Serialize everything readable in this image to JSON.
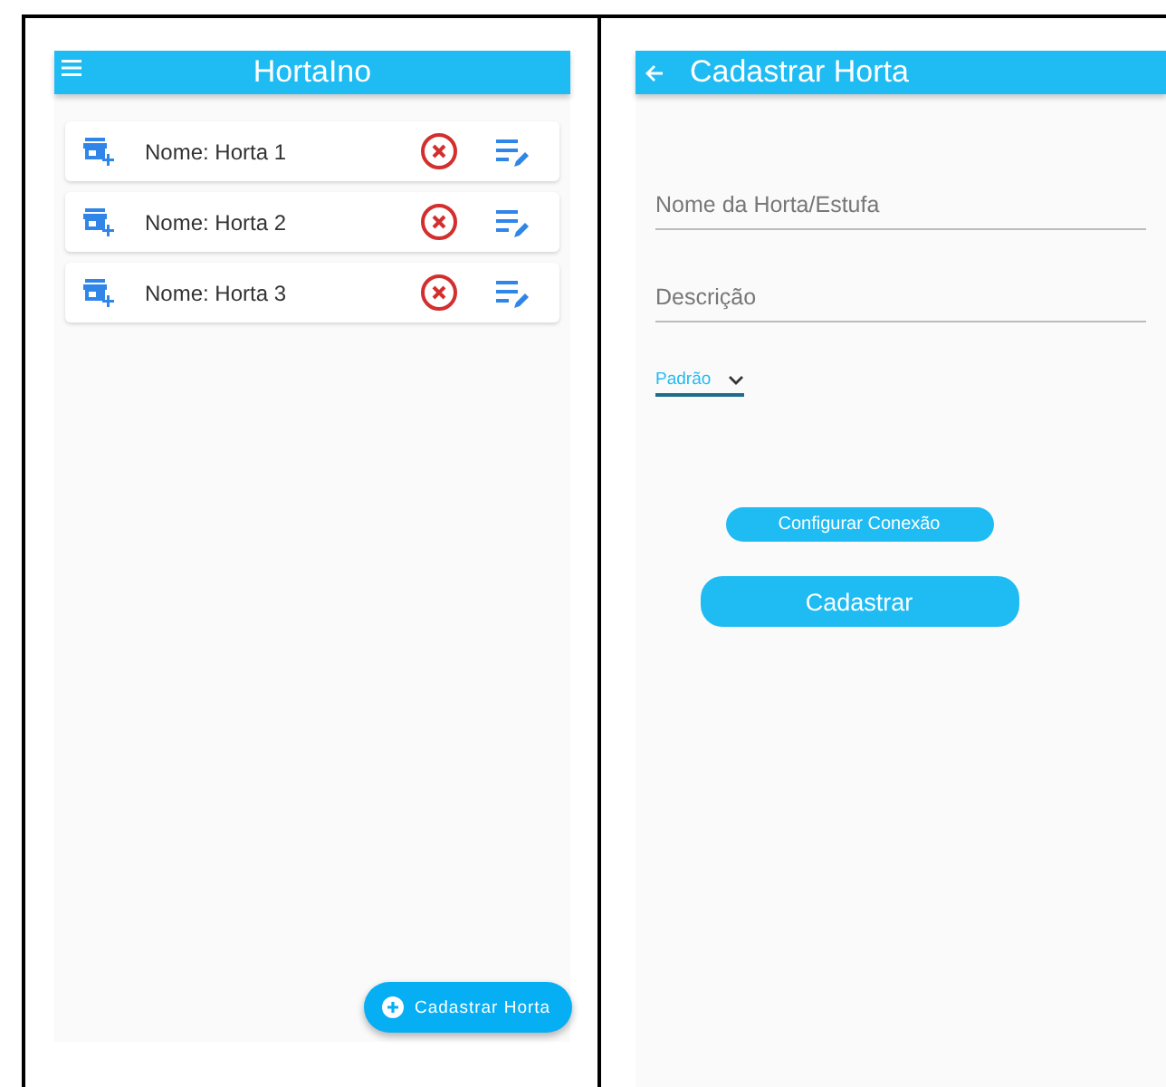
{
  "list_screen": {
    "app_bar": {
      "title": "HortaIno"
    },
    "items": [
      {
        "label": "Nome: Horta 1"
      },
      {
        "label": "Nome: Horta 2"
      },
      {
        "label": "Nome: Horta 3"
      }
    ],
    "fab": {
      "label": "Cadastrar Horta"
    }
  },
  "form_screen": {
    "app_bar": {
      "title": "Cadastrar Horta"
    },
    "fields": [
      {
        "placeholder": "Nome da Horta/Estufa"
      },
      {
        "placeholder": "Descrição"
      }
    ],
    "dropdown": {
      "value": "Padrão"
    },
    "buttons": [
      {
        "label": "Configurar Conexão",
        "kind": "small"
      },
      {
        "label": "Cadastrar",
        "kind": "large"
      }
    ]
  }
}
